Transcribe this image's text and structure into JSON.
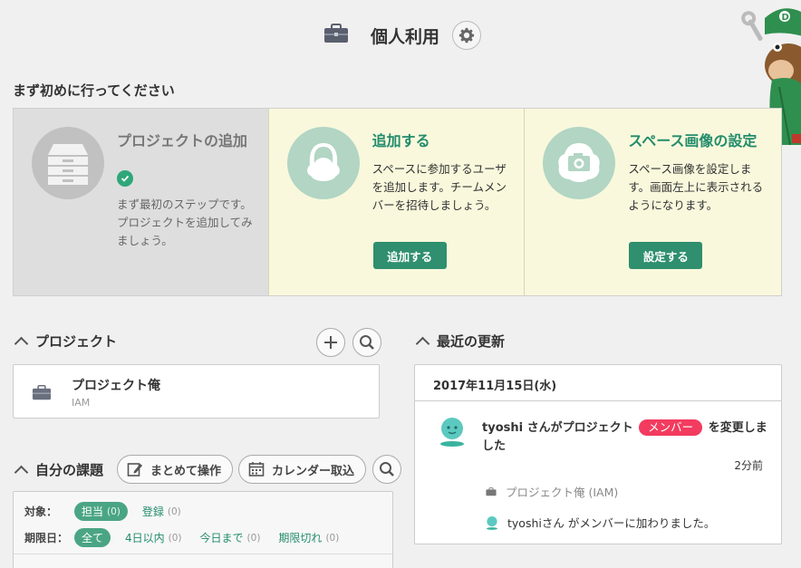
{
  "header": {
    "title": "個人利用"
  },
  "icons": {
    "space": "briefcase-icon",
    "settings": "gear-icon",
    "mascot": "mascot-character-icon"
  },
  "first_steps": {
    "title": "まず初めに行ってください",
    "steps": [
      {
        "title": "プロジェクトの追加",
        "desc": "まず最初のステップです。プロジェクトを追加してみましょう。",
        "completed": true
      },
      {
        "title": "追加する",
        "desc": "スペースに参加するユーザを追加します。チームメンバーを招待しましょう。",
        "button": "追加する"
      },
      {
        "title": "スペース画像の設定",
        "desc": "スペース画像を設定します。画面左上に表示されるようになります。",
        "button": "設定する"
      }
    ]
  },
  "projects": {
    "title": "プロジェクト",
    "items": [
      {
        "name": "プロジェクト俺",
        "key": "IAM"
      }
    ]
  },
  "my_issues": {
    "title": "自分の課題",
    "bulk_button": "まとめて操作",
    "calendar_button": "カレンダー取込",
    "target_label": "対象：",
    "target_filters": [
      {
        "label": "担当",
        "count": "(0)",
        "active": true
      },
      {
        "label": "登録",
        "count": "(0)",
        "active": false
      }
    ],
    "due_label": "期限日：",
    "due_filters": [
      {
        "label": "全て",
        "count": "",
        "active": true
      },
      {
        "label": "4日以内",
        "count": "(0)",
        "active": false
      },
      {
        "label": "今日まで",
        "count": "(0)",
        "active": false
      },
      {
        "label": "期限切れ",
        "count": "(0)",
        "active": false
      }
    ]
  },
  "recent": {
    "title": "最近の更新",
    "date": "2017年11月15日(水)",
    "update": {
      "user": "tyoshi",
      "text_before": "tyoshi さんがプロジェクト",
      "badge": "メンバー",
      "text_after": "を変更しました",
      "time": "2分前",
      "project_line": "プロジェクト俺 (IAM)",
      "detail_line": "tyoshiさん がメンバーに加わりました。"
    }
  },
  "colors": {
    "accent": "#2f8f6e",
    "badge": "#f23b5f",
    "step_bg": "#f9f8dc"
  }
}
